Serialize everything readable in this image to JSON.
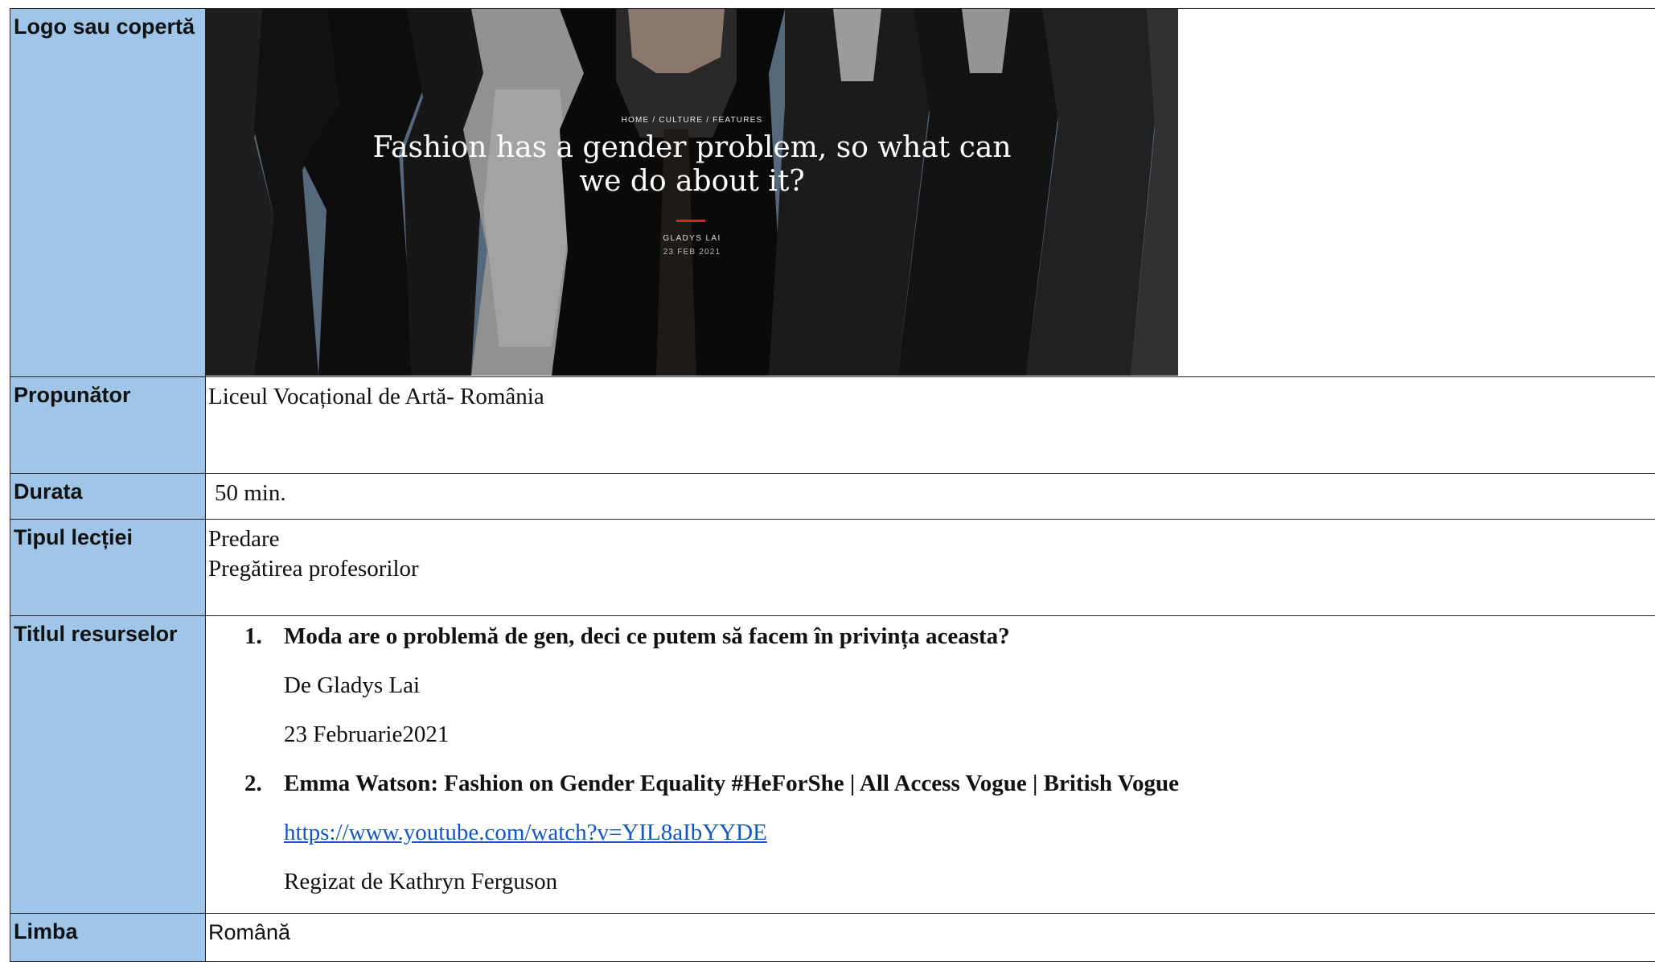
{
  "rows": {
    "cover": {
      "label": "Logo sau copertă",
      "image": {
        "breadcrumb": "HOME / CULTURE / FEATURES",
        "headline": "Fashion has a gender problem, so what can we do about it?",
        "author": "GLADYS LAI",
        "date": "23 FEB 2021"
      }
    },
    "proposer": {
      "label": "Propunător",
      "value": "Liceul Vocațional de Artă- România"
    },
    "duration": {
      "label": "Durata",
      "value": "50 min."
    },
    "lesson_type": {
      "label": "Tipul lecției",
      "values": [
        "Predare",
        "Pregătirea profesorilor"
      ]
    },
    "resources": {
      "label": "Titlul resurselor",
      "items": [
        {
          "number": "1.",
          "title": "Moda are o problemă de gen, deci ce putem să facem în privința aceasta?",
          "lines": [
            "De Gladys Lai",
            "23 Februarie2021"
          ]
        },
        {
          "number": "2.",
          "title": "Emma Watson: Fashion on Gender Equality #HeForShe | All Access Vogue | British Vogue",
          "link": "https://www.youtube.com/watch?v=YIL8aIbYYDE",
          "lines": [
            "Regizat de Kathryn Ferguson"
          ]
        }
      ]
    },
    "language": {
      "label": "Limba",
      "value": "Română"
    }
  }
}
